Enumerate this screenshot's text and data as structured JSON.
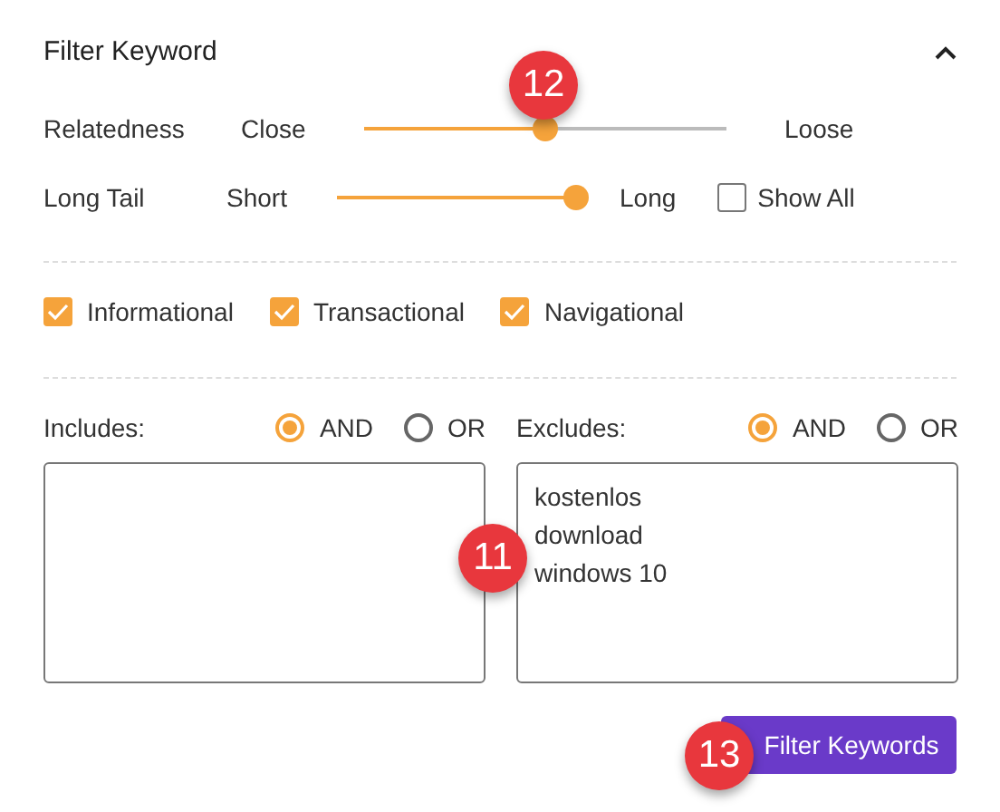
{
  "panel": {
    "title": "Filter Keyword",
    "expanded": true
  },
  "sliders": [
    {
      "label": "Relatedness",
      "min_label": "Close",
      "max_label": "Loose",
      "level": 0.5
    },
    {
      "label": "Long Tail",
      "min_label": "Short",
      "max_label": "Long",
      "level": 1.0
    }
  ],
  "show_all": {
    "label": "Show All",
    "checked": false
  },
  "intents": [
    {
      "label": "Informational",
      "checked": true
    },
    {
      "label": "Transactional",
      "checked": true
    },
    {
      "label": "Navigational",
      "checked": true
    }
  ],
  "filters": [
    {
      "label": "Includes:",
      "options": [
        {
          "label": "AND",
          "selected": true
        },
        {
          "label": "OR",
          "selected": false
        }
      ]
    },
    {
      "label": "Excludes:",
      "options": [
        {
          "label": "AND",
          "selected": true
        },
        {
          "label": "OR",
          "selected": false
        }
      ],
      "lines": [
        "kostenlos",
        "download",
        "windows 10"
      ]
    }
  ],
  "button": "Filter Keywords",
  "callouts": [
    {
      "text": "12"
    },
    {
      "text": "11"
    },
    {
      "text": "13"
    }
  ]
}
